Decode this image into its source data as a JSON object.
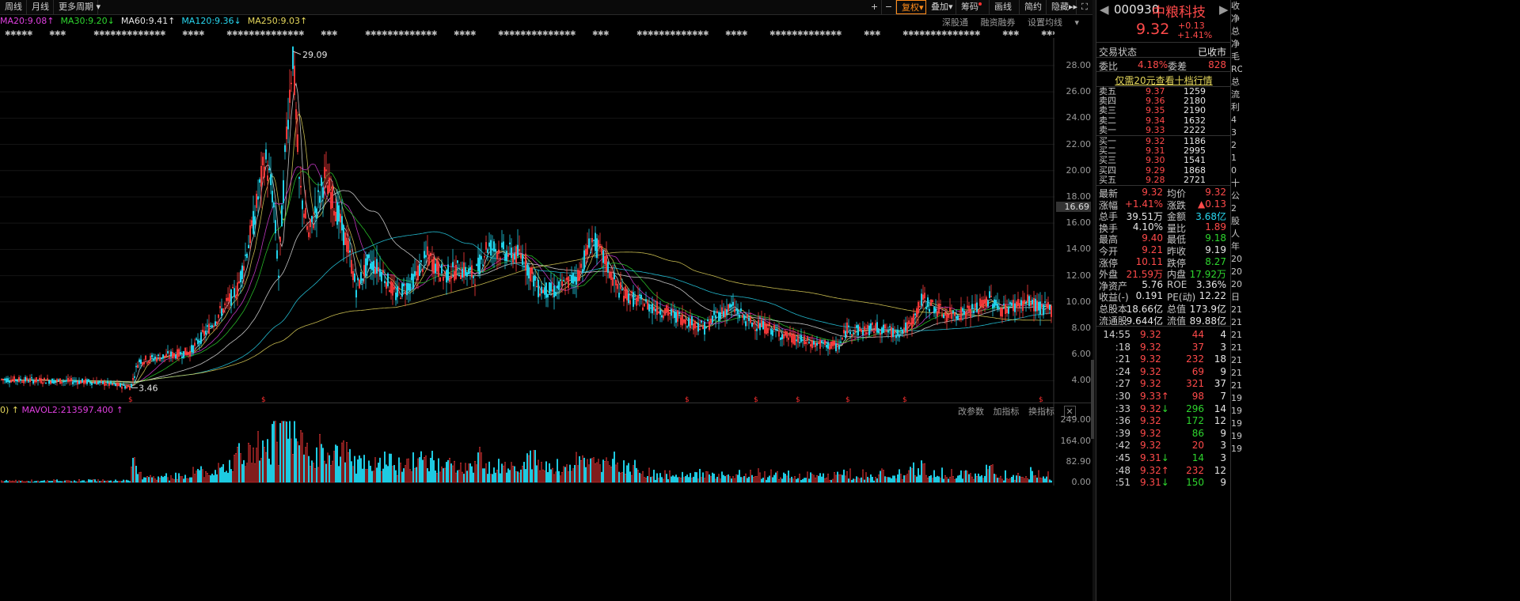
{
  "toolbar": {
    "left": [
      "周线",
      "月线",
      "更多周期"
    ],
    "right": [
      "复权",
      "叠加",
      "筹码",
      "画线",
      "简约",
      "隐藏"
    ]
  },
  "ma_line": [
    {
      "label": "MA20:9.08",
      "arrow": "↑",
      "color": "#e040e0"
    },
    {
      "label": "MA30:9.20",
      "arrow": "↓",
      "color": "#2ed62e"
    },
    {
      "label": "MA60:9.41",
      "arrow": "↑",
      "color": "#e6e6e6"
    },
    {
      "label": "MA120:9.36",
      "arrow": "↓",
      "color": "#28d7f0"
    },
    {
      "label": "MA250:9.03",
      "arrow": "↑",
      "color": "#e6d85c"
    }
  ],
  "chart_links": [
    "深股通",
    "融资融券",
    "设置均线"
  ],
  "price_chart": {
    "y_ticks": [
      "28.00",
      "26.00",
      "24.00",
      "22.00",
      "20.00",
      "18.00",
      "16.00",
      "14.00",
      "12.00",
      "10.00",
      "8.00",
      "6.00",
      "4.00"
    ],
    "current_flag": "16.69",
    "high_label": "29.09",
    "low_label": "3.46"
  },
  "volume": {
    "header": "MAVOL2:213597.400",
    "tools": [
      "改参数",
      "加指标",
      "换指标"
    ],
    "y_ticks": [
      "249.00",
      "164.00",
      "82.90",
      "0.00"
    ]
  },
  "stock": {
    "code": "000930",
    "name": "中粮科技",
    "price": "9.32",
    "change": "+0.13",
    "change_pct": "+1.41%",
    "trade_status_label": "交易状态",
    "trade_status": "已收市",
    "weibi_label": "委比",
    "weibi": "4.18%",
    "weicha_label": "委差",
    "weicha": "828",
    "promo": "仅需20元查看十档行情"
  },
  "order_book": {
    "sell": [
      {
        "label": "卖五",
        "price": "9.37",
        "vol": "1259"
      },
      {
        "label": "卖四",
        "price": "9.36",
        "vol": "2180"
      },
      {
        "label": "卖三",
        "price": "9.35",
        "vol": "2190"
      },
      {
        "label": "卖二",
        "price": "9.34",
        "vol": "1632"
      },
      {
        "label": "卖一",
        "price": "9.33",
        "vol": "2222"
      }
    ],
    "buy": [
      {
        "label": "买一",
        "price": "9.32",
        "vol": "1186"
      },
      {
        "label": "买二",
        "price": "9.31",
        "vol": "2995"
      },
      {
        "label": "买三",
        "price": "9.30",
        "vol": "1541"
      },
      {
        "label": "买四",
        "price": "9.29",
        "vol": "1868"
      },
      {
        "label": "买五",
        "price": "9.28",
        "vol": "2721"
      }
    ]
  },
  "quote_stats": [
    {
      "k1": "最新",
      "v1": "9.32",
      "c1": "red",
      "k2": "均价",
      "v2": "9.32",
      "c2": "red"
    },
    {
      "k1": "涨幅",
      "v1": "+1.41%",
      "c1": "red",
      "k2": "涨跌",
      "v2": "▲0.13",
      "c2": "red"
    },
    {
      "k1": "总手",
      "v1": "39.51万",
      "c1": "white",
      "k2": "金额",
      "v2": "3.68亿",
      "c2": "cyan"
    },
    {
      "k1": "换手",
      "v1": "4.10%",
      "c1": "white",
      "k2": "量比",
      "v2": "1.89",
      "c2": "red"
    },
    {
      "k1": "最高",
      "v1": "9.40",
      "c1": "red",
      "k2": "最低",
      "v2": "9.18",
      "c2": "green"
    },
    {
      "k1": "今开",
      "v1": "9.21",
      "c1": "red",
      "k2": "昨收",
      "v2": "9.19",
      "c2": "white"
    },
    {
      "k1": "涨停",
      "v1": "10.11",
      "c1": "red",
      "k2": "跌停",
      "v2": "8.27",
      "c2": "green"
    },
    {
      "k1": "外盘",
      "v1": "21.59万",
      "c1": "red",
      "k2": "内盘",
      "v2": "17.92万",
      "c2": "green"
    },
    {
      "k1": "净资产",
      "v1": "5.76",
      "c1": "white",
      "k2": "ROE",
      "v2": "3.36%",
      "c2": "white"
    },
    {
      "k1": "收益(-)",
      "v1": "0.191",
      "c1": "white",
      "k2": "PE(动)",
      "v2": "12.22",
      "c2": "white"
    },
    {
      "k1": "总股本",
      "v1": "18.66亿",
      "c1": "white",
      "k2": "总值",
      "v2": "173.9亿",
      "c2": "white"
    },
    {
      "k1": "流通股",
      "v1": "9.644亿",
      "c1": "white",
      "k2": "流值",
      "v2": "89.88亿",
      "c2": "white"
    }
  ],
  "ticks": [
    {
      "t": "14:55",
      "p": "9.32",
      "a": "",
      "v": "44",
      "n": "4",
      "vc": "red"
    },
    {
      "t": ":18",
      "p": "9.32",
      "a": "",
      "v": "37",
      "n": "3",
      "vc": "red"
    },
    {
      "t": ":21",
      "p": "9.32",
      "a": "",
      "v": "232",
      "n": "18",
      "vc": "red"
    },
    {
      "t": ":24",
      "p": "9.32",
      "a": "",
      "v": "69",
      "n": "9",
      "vc": "red"
    },
    {
      "t": ":27",
      "p": "9.32",
      "a": "",
      "v": "321",
      "n": "37",
      "vc": "red"
    },
    {
      "t": ":30",
      "p": "9.33",
      "a": "↑",
      "v": "98",
      "n": "7",
      "vc": "red"
    },
    {
      "t": ":33",
      "p": "9.32",
      "a": "↓",
      "v": "296",
      "n": "14",
      "vc": "green"
    },
    {
      "t": ":36",
      "p": "9.32",
      "a": "",
      "v": "172",
      "n": "12",
      "vc": "green"
    },
    {
      "t": ":39",
      "p": "9.32",
      "a": "",
      "v": "86",
      "n": "9",
      "vc": "green"
    },
    {
      "t": ":42",
      "p": "9.32",
      "a": "",
      "v": "20",
      "n": "3",
      "vc": "red"
    },
    {
      "t": ":45",
      "p": "9.31",
      "a": "↓",
      "v": "14",
      "n": "3",
      "vc": "green"
    },
    {
      "t": ":48",
      "p": "9.32",
      "a": "↑",
      "v": "232",
      "n": "12",
      "vc": "red"
    },
    {
      "t": ":51",
      "p": "9.31",
      "a": "↓",
      "v": "150",
      "n": "9",
      "vc": "green"
    }
  ],
  "edge_text": [
    "收",
    "净",
    "总",
    "净",
    "毛",
    "RO",
    "总",
    "流",
    "利",
    "4",
    "3",
    "2",
    "1",
    "0",
    "十",
    "公",
    "2",
    "股",
    "人",
    "年",
    "20",
    "20",
    "20",
    "日",
    "21",
    "21",
    "21",
    "21",
    "21",
    "21",
    "21",
    "19",
    "19",
    "19",
    "19",
    "19"
  ]
}
